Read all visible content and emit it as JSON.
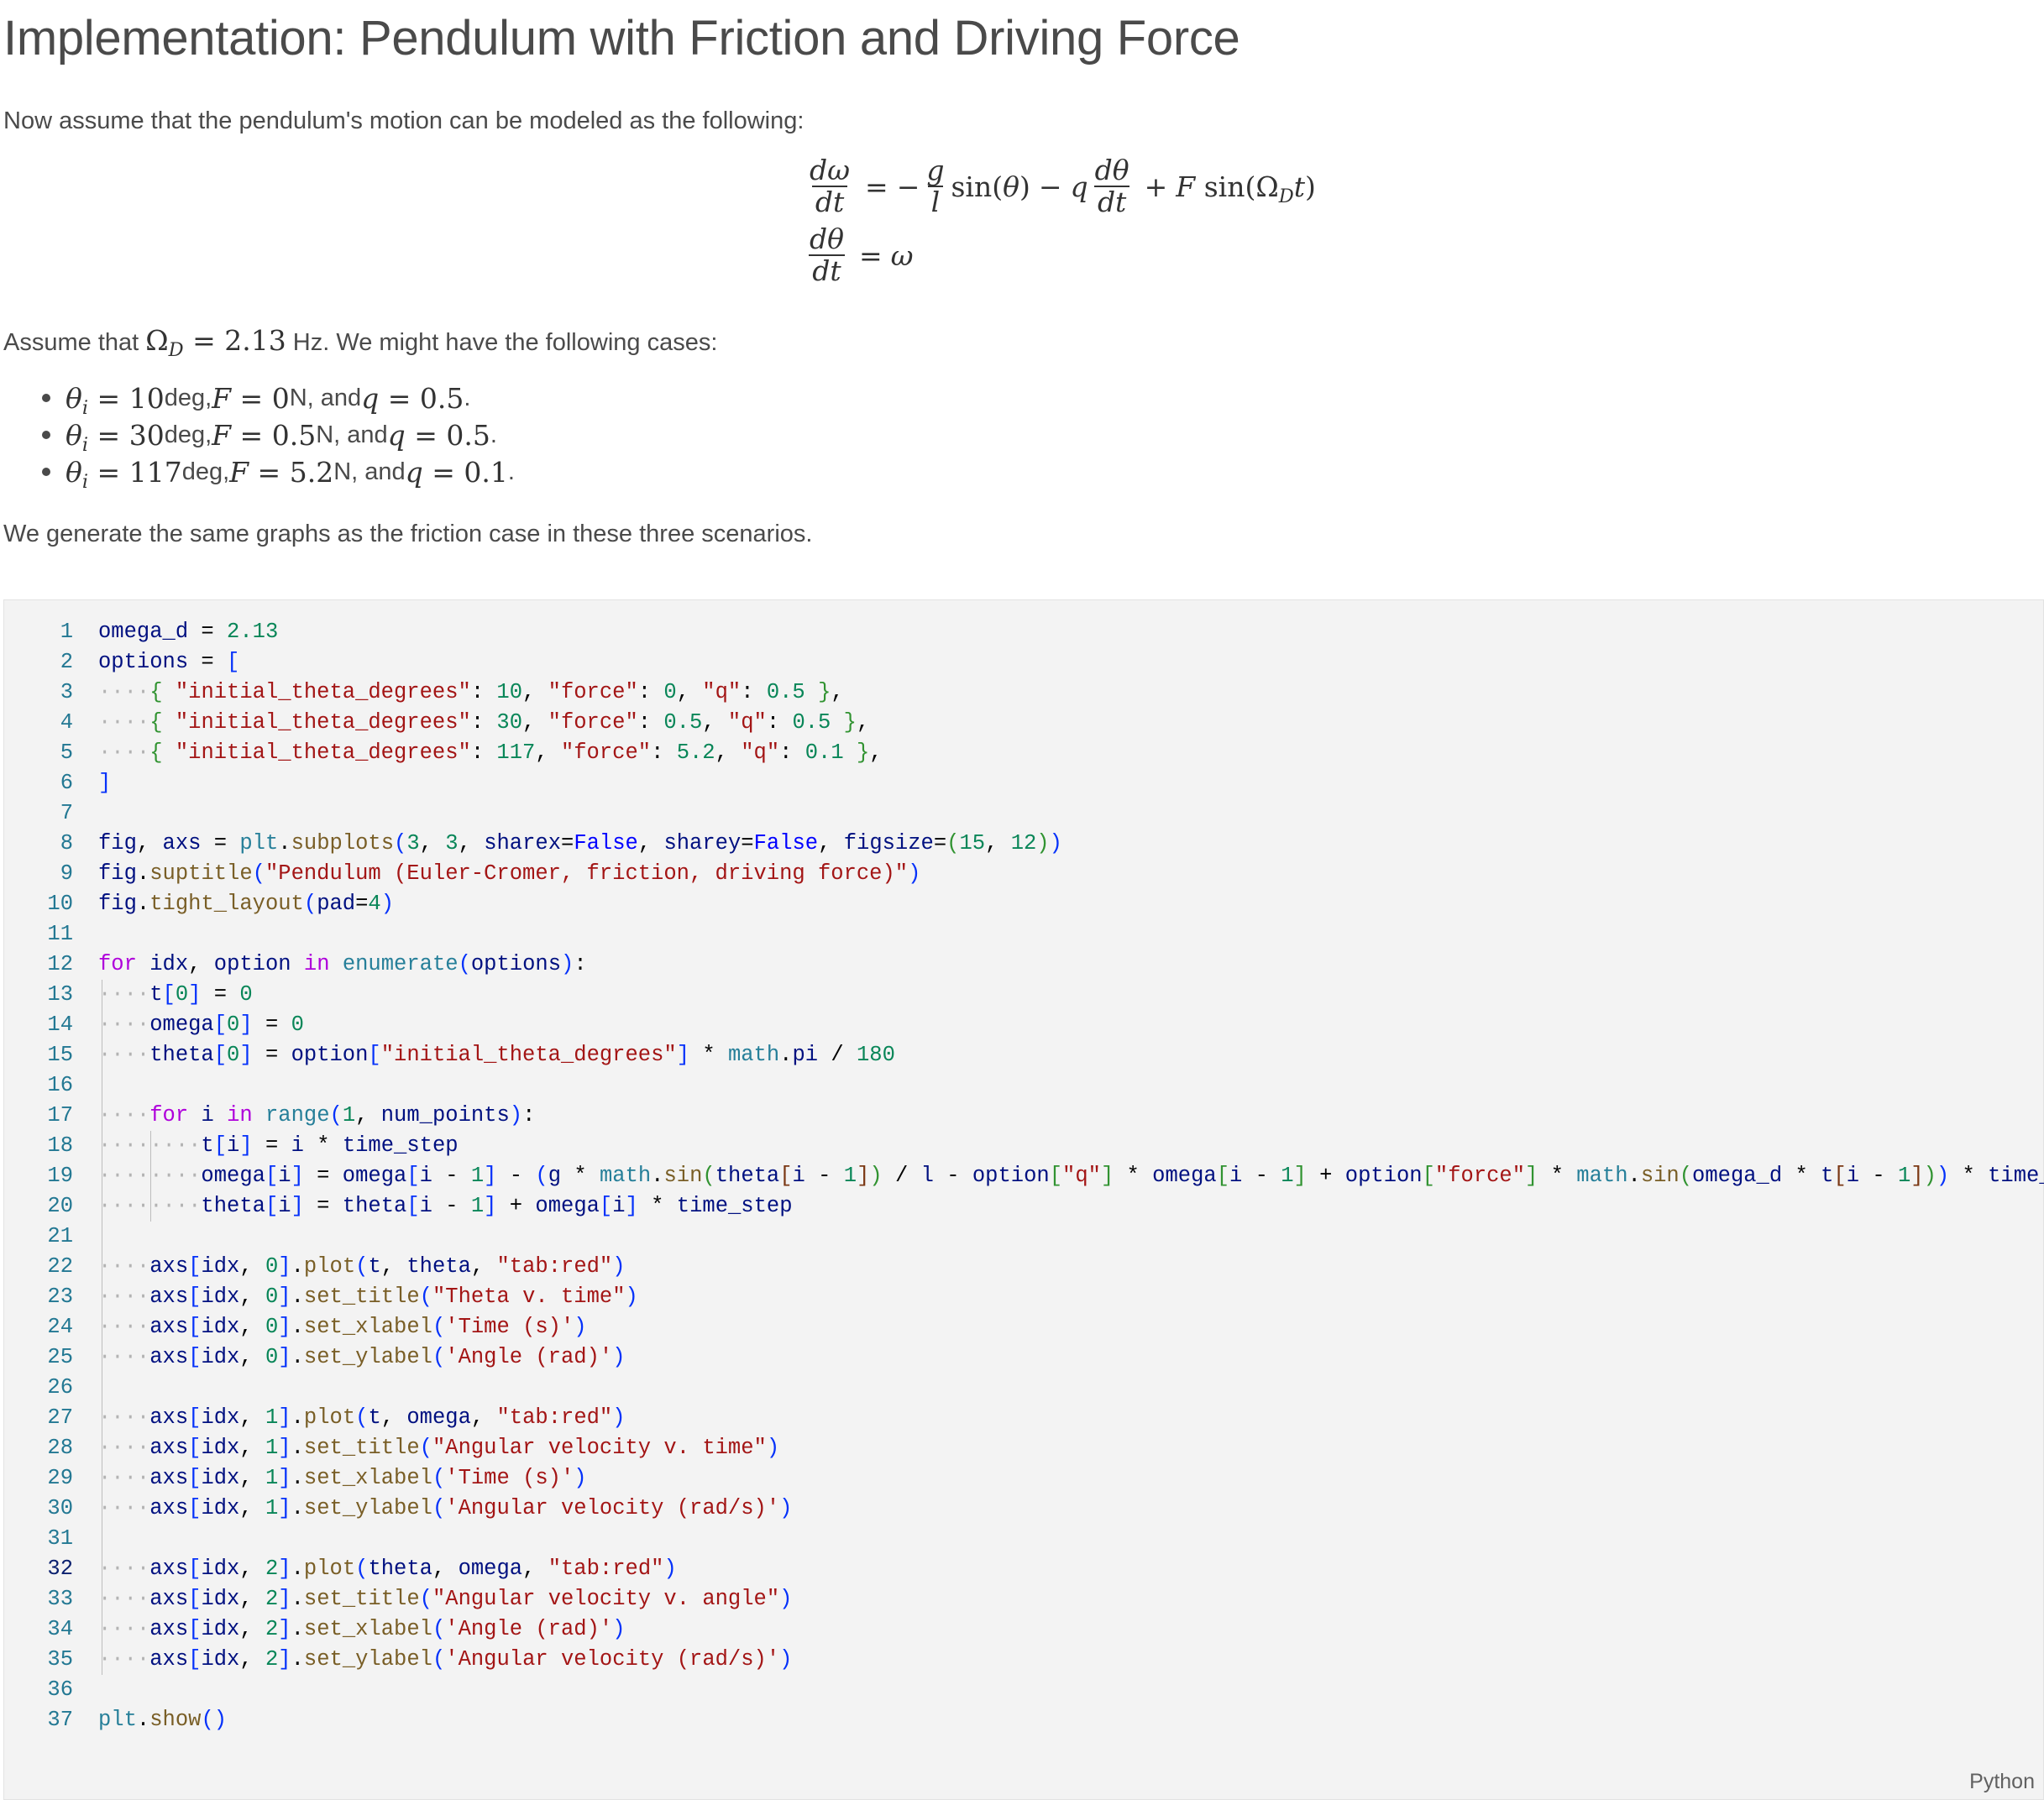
{
  "markdown": {
    "title": "Implementation: Pendulum with Friction and Driving Force",
    "intro": "Now assume that the pendulum's motion can be modeled as the following:",
    "assume_prefix": "Assume that ",
    "assume_math_symbol": "Ω",
    "assume_math_sub": "D",
    "assume_math_value": "= 2.13",
    "assume_suffix": " Hz. We might have the following cases:",
    "cases": [
      {
        "theta": "10",
        "force": "0",
        "q": "0.5"
      },
      {
        "theta": "30",
        "force": "0.5",
        "q": "0.5"
      },
      {
        "theta": "117",
        "force": "5.2",
        "q": "0.1"
      }
    ],
    "case_deg": " deg, ",
    "case_n": " N, and ",
    "case_end": ".",
    "outro": "We generate the same graphs as the friction case in these three scenarios."
  },
  "cell": {
    "language": "Python",
    "line_numbers": [
      "1",
      "2",
      "3",
      "4",
      "5",
      "6",
      "7",
      "8",
      "9",
      "10",
      "11",
      "12",
      "13",
      "14",
      "15",
      "16",
      "17",
      "18",
      "19",
      "20",
      "21",
      "22",
      "23",
      "24",
      "25",
      "26",
      "27",
      "28",
      "29",
      "30",
      "31",
      "32",
      "33",
      "34",
      "35",
      "36",
      "37"
    ]
  }
}
